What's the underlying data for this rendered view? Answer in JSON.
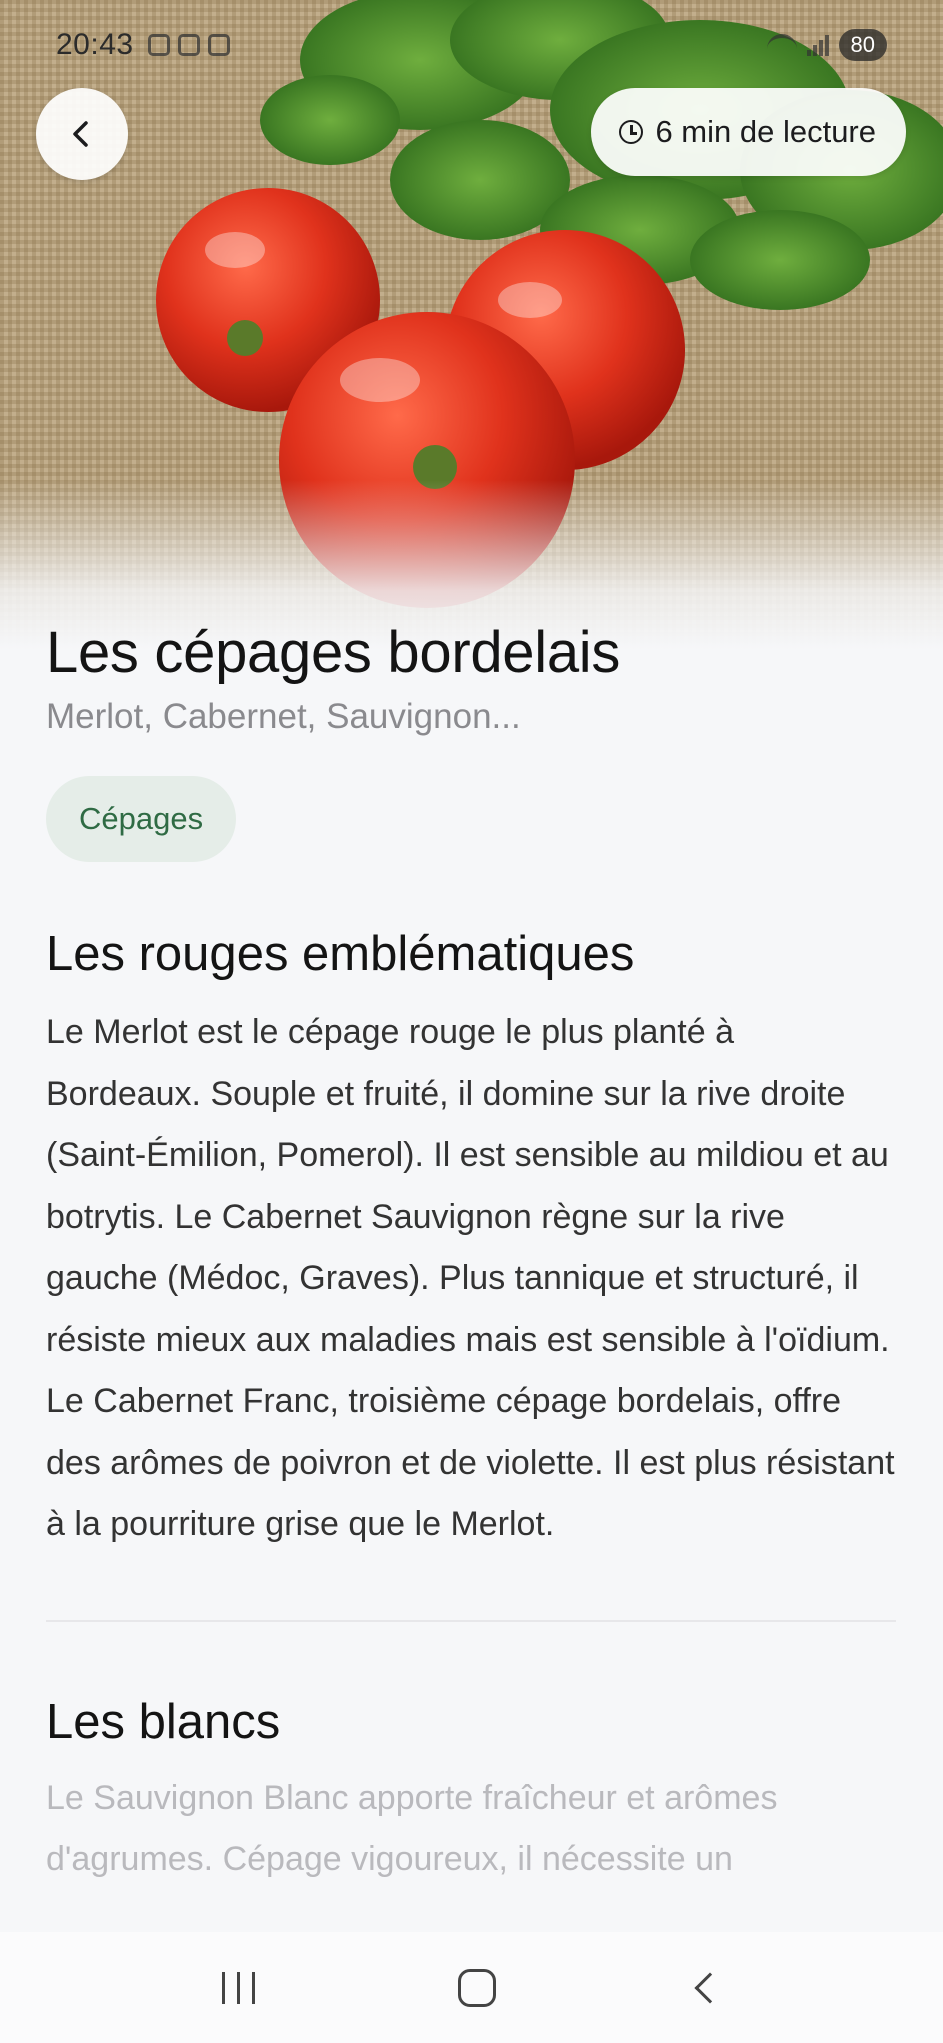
{
  "status_bar": {
    "time": "20:43",
    "battery": "80"
  },
  "header": {
    "back_icon": "chevron-left-icon",
    "reading_time_icon": "clock-icon",
    "reading_time": "6 min de lecture"
  },
  "hero_image": {
    "description_icon": "tomato-photo"
  },
  "article": {
    "title": "Les cépages bordelais",
    "subtitle": "Merlot, Cabernet, Sauvignon...",
    "tag": "Cépages",
    "sections": [
      {
        "heading": "Les rouges emblématiques",
        "body": "Le Merlot est le cépage rouge le plus planté à Bordeaux. Souple et fruité, il domine sur la rive droite (Saint-Émilion, Pomerol). Il est sensible au mildiou et au botrytis. Le Cabernet Sauvignon règne sur la rive gauche (Médoc, Graves). Plus tannique et structuré, il résiste mieux aux maladies mais est sensible à l'oïdium. Le Cabernet Franc, troisième cépage bordelais, offre des arômes de poivron et de violette. Il est plus résistant à la pourriture grise que le Merlot."
      },
      {
        "heading": "Les blancs",
        "body": "Le Sauvignon Blanc apporte fraîcheur et arômes d'agrumes. Cépage vigoureux, il nécessite un"
      }
    ]
  },
  "colors": {
    "background": "#f6f7f9",
    "tag_bg": "#e5ede8",
    "tag_text": "#2f6b44"
  }
}
